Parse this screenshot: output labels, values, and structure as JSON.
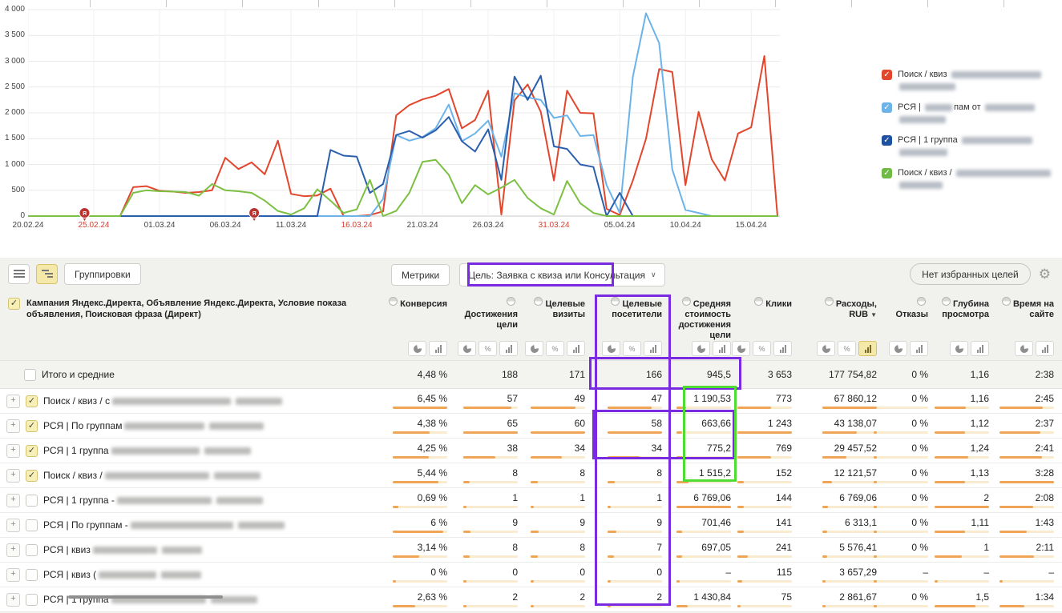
{
  "chart_data": {
    "type": "line",
    "title": "",
    "ylabel": "",
    "xlabel": "",
    "ylim": [
      0,
      4000
    ],
    "yticks": [
      0,
      500,
      1000,
      1500,
      2000,
      2500,
      3000,
      3500,
      4000
    ],
    "grid": true,
    "legend_position": "right",
    "x_tick_days": [
      0,
      5,
      10,
      15,
      20,
      25,
      30,
      35,
      40,
      45,
      50,
      55
    ],
    "x_tick_labels": [
      "20.02.24",
      "25.02.24",
      "01.03.24",
      "06.03.24",
      "11.03.24",
      "16.03.24",
      "21.03.24",
      "26.03.24",
      "31.03.24",
      "05.04.24",
      "10.04.24",
      "15.04.24"
    ],
    "x_tick_red": [
      false,
      true,
      false,
      false,
      false,
      true,
      false,
      false,
      true,
      false,
      false,
      false
    ],
    "annotations": [
      {
        "day": 4.3,
        "glyph": "Я"
      },
      {
        "day": 17.2,
        "glyph": "Я"
      }
    ],
    "series": [
      {
        "name": "Поиск / квиз",
        "color": "#e2462c",
        "values": [
          0,
          0,
          0,
          0,
          0,
          0,
          0,
          0,
          560,
          580,
          490,
          475,
          450,
          465,
          500,
          1130,
          910,
          1040,
          810,
          1460,
          430,
          385,
          400,
          530,
          0,
          0,
          20,
          90,
          1950,
          2150,
          2260,
          2330,
          2460,
          1700,
          1860,
          2430,
          30,
          2240,
          2550,
          2020,
          690,
          2430,
          2000,
          1990,
          140,
          20,
          690,
          1500,
          2850,
          2790,
          600,
          2020,
          1100,
          690,
          1600,
          1720,
          3100,
          0
        ]
      },
      {
        "name": "РСЯ | По группам от",
        "color": "#6cb3e8",
        "values": [
          0,
          0,
          0,
          0,
          0,
          0,
          0,
          0,
          0,
          0,
          0,
          0,
          0,
          0,
          0,
          0,
          0,
          0,
          0,
          0,
          0,
          0,
          0,
          0,
          0,
          0,
          0,
          330,
          1570,
          1460,
          1530,
          1700,
          2160,
          1450,
          1600,
          1850,
          1150,
          2380,
          2300,
          2250,
          1900,
          1950,
          1550,
          1570,
          600,
          60,
          2700,
          3930,
          3350,
          900,
          120,
          60,
          0,
          0,
          0,
          0,
          0,
          0
        ]
      },
      {
        "name": "РСЯ | 1 группа",
        "color": "#2b5fad",
        "values": [
          0,
          0,
          0,
          0,
          0,
          0,
          0,
          0,
          0,
          0,
          0,
          0,
          0,
          0,
          0,
          0,
          0,
          0,
          0,
          0,
          0,
          0,
          0,
          1280,
          1170,
          1150,
          450,
          620,
          1570,
          1650,
          1520,
          1660,
          1920,
          1450,
          1250,
          1680,
          700,
          2700,
          2250,
          2720,
          1350,
          1300,
          1000,
          950,
          0,
          450,
          0,
          0,
          0,
          0,
          0,
          0,
          0,
          0,
          0,
          0,
          0,
          0
        ]
      },
      {
        "name": "Поиск / квиз /",
        "color": "#7cc043",
        "values": [
          0,
          0,
          0,
          0,
          0,
          0,
          0,
          0,
          450,
          500,
          480,
          475,
          465,
          395,
          620,
          500,
          480,
          450,
          300,
          100,
          30,
          150,
          520,
          300,
          60,
          130,
          700,
          0,
          100,
          450,
          1050,
          1090,
          800,
          250,
          600,
          420,
          550,
          700,
          350,
          150,
          30,
          680,
          250,
          60,
          0,
          0,
          0,
          0,
          0,
          0,
          0,
          0,
          0,
          0,
          0,
          0,
          0,
          0
        ]
      }
    ]
  },
  "legend": {
    "items": [
      {
        "color": "#e2462c",
        "parts": [
          {
            "text": "Поиск / квиз "
          },
          {
            "blur": 112
          }
        ],
        "line2_blur": 70
      },
      {
        "color": "#6cb3e8",
        "parts": [
          {
            "text": "РСЯ | "
          },
          {
            "blur": 34
          },
          {
            "text": "пам от "
          },
          {
            "blur": 62
          }
        ],
        "line2_blur": 58
      },
      {
        "color": "#1e51a0",
        "parts": [
          {
            "text": "РСЯ | 1 группа "
          },
          {
            "blur": 88
          }
        ],
        "line2_blur": 60
      },
      {
        "color": "#6fbb45",
        "parts": [
          {
            "text": "Поиск / квиз / "
          },
          {
            "blur": 118
          }
        ],
        "line2_blur": 54
      }
    ]
  },
  "toolbar": {
    "view_list_icon": "list-view",
    "view_tree_icon": "tree-view",
    "groupings_label": "Группировки",
    "metrics_label": "Метрики",
    "goal_label": "Цель:",
    "goal_value": "Заявка с квиза или Консультация",
    "goal_chevron": "∨",
    "no_goals_label": "Нет избранных целей",
    "gear_icon": "⚙"
  },
  "table": {
    "name_header": "Кампания Яндекс.Директа, Объявление Яндекс.Директа, Условие показа объявления, Поисковая фраза (Директ)",
    "columns": [
      {
        "label": "Конверсия",
        "icons": [
          "pie",
          "bar"
        ]
      },
      {
        "label": "Достижения цели",
        "icons": [
          "pie",
          "pct",
          "bar"
        ]
      },
      {
        "label": "Целевые визиты",
        "icons": [
          "pie",
          "pct",
          "bar"
        ]
      },
      {
        "label": "Целевые посетители",
        "icons": [
          "pie",
          "pct",
          "bar"
        ]
      },
      {
        "label": "Средняя стоимость достижения цели",
        "icons": [
          "pie",
          "bar"
        ]
      },
      {
        "label": "Клики",
        "icons": [
          "pie",
          "pct",
          "bar"
        ]
      },
      {
        "label": "Расходы, RUB",
        "sort": "▼",
        "icons": [
          "pie",
          "pct",
          "bar-active"
        ]
      },
      {
        "label": "Отказы",
        "icons": [
          "pie",
          "bar"
        ]
      },
      {
        "label": "Глубина просмотра",
        "icons": [
          "pie",
          "bar"
        ]
      },
      {
        "label": "Время на сайте",
        "icons": [
          "pie",
          "bar"
        ]
      }
    ],
    "totals": {
      "label": "Итого и средние",
      "checked": false,
      "values": [
        "4,48 %",
        "188",
        "171",
        "166",
        "945,5",
        "3 653",
        "177 754,82",
        "0 %",
        "1,16",
        "2:38"
      ]
    },
    "rows": [
      {
        "checked": true,
        "parts": [
          {
            "text": "Поиск / квиз / с"
          },
          {
            "blur": 148
          },
          {
            "blur": 58
          }
        ],
        "values": [
          "6,45 %",
          "57",
          "49",
          "47",
          "1 190,53",
          "773",
          "67 860,12",
          "0 %",
          "1,16",
          "2:45"
        ]
      },
      {
        "checked": true,
        "parts": [
          {
            "text": "РСЯ | По группам"
          },
          {
            "blur": 100
          },
          {
            "blur": 68
          }
        ],
        "values": [
          "4,38 %",
          "65",
          "60",
          "58",
          "663,66",
          "1 243",
          "43 138,07",
          "0 %",
          "1,12",
          "2:37"
        ]
      },
      {
        "checked": true,
        "parts": [
          {
            "text": "РСЯ | 1 группа"
          },
          {
            "blur": 110
          },
          {
            "blur": 58
          }
        ],
        "values": [
          "4,25 %",
          "38",
          "34",
          "34",
          "775,2",
          "769",
          "29 457,52",
          "0 %",
          "1,24",
          "2:41"
        ]
      },
      {
        "checked": true,
        "parts": [
          {
            "text": "Поиск / квиз /"
          },
          {
            "blur": 130
          },
          {
            "blur": 58
          }
        ],
        "values": [
          "5,44 %",
          "8",
          "8",
          "8",
          "1 515,2",
          "152",
          "12 121,57",
          "0 %",
          "1,13",
          "3:28"
        ]
      },
      {
        "checked": false,
        "parts": [
          {
            "text": "РСЯ | 1 группа -"
          },
          {
            "blur": 118
          },
          {
            "blur": 58
          }
        ],
        "values": [
          "0,69 %",
          "1",
          "1",
          "1",
          "6 769,06",
          "144",
          "6 769,06",
          "0 %",
          "2",
          "2:08"
        ]
      },
      {
        "checked": false,
        "parts": [
          {
            "text": "РСЯ | По группам -"
          },
          {
            "blur": 128
          },
          {
            "blur": 58
          }
        ],
        "values": [
          "6 %",
          "9",
          "9",
          "9",
          "701,46",
          "141",
          "6 313,1",
          "0 %",
          "1,11",
          "1:43"
        ]
      },
      {
        "checked": false,
        "parts": [
          {
            "text": "РСЯ | квиз"
          },
          {
            "blur": 80
          },
          {
            "blur": 50
          }
        ],
        "values": [
          "3,14 %",
          "8",
          "8",
          "7",
          "697,05",
          "241",
          "5 576,41",
          "0 %",
          "1",
          "2:11"
        ]
      },
      {
        "checked": false,
        "parts": [
          {
            "text": "РСЯ | квиз ("
          },
          {
            "blur": 72
          },
          {
            "blur": 50
          }
        ],
        "values": [
          "0 %",
          "0",
          "0",
          "0",
          "–",
          "115",
          "3 657,29",
          "–",
          "–",
          "–"
        ]
      },
      {
        "checked": false,
        "parts": [
          {
            "text": "РСЯ | 1 группа"
          },
          {
            "blur": 118
          },
          {
            "blur": 58
          }
        ],
        "values": [
          "2,63 %",
          "2",
          "2",
          "2",
          "1 430,84",
          "75",
          "2 861,67",
          "0 %",
          "1,5",
          "1:34"
        ]
      }
    ]
  }
}
